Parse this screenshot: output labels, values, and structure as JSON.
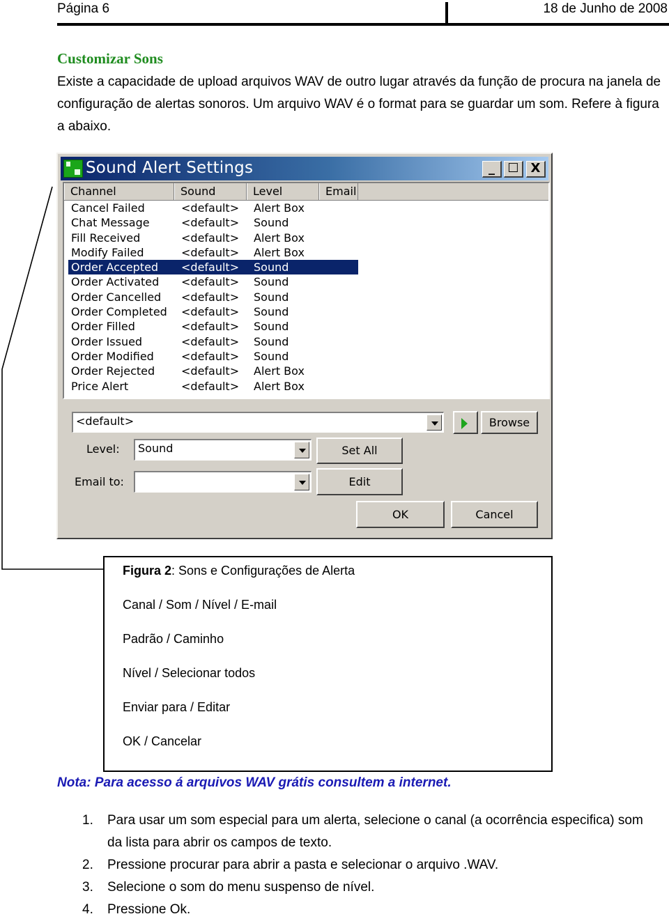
{
  "header": {
    "page_label": "Página 6",
    "date": "18 de Junho de 2008"
  },
  "section": {
    "title": "Customizar Sons",
    "paragraph": "Existe a capacidade de upload arquivos WAV de outro lugar através da função de procura na janela de configuração de alertas sonoros. Um arquivo WAV é o format para se guardar um som. Refere à figura a abaixo."
  },
  "dialog": {
    "title": "Sound Alert Settings",
    "icons": {
      "app": "app-logo-icon",
      "minimize": "minimize-icon",
      "maximize": "maximize-icon",
      "close": "close-icon",
      "play": "play-icon",
      "dropdown": "chevron-down-icon"
    },
    "title_buttons": {
      "minimize": "_",
      "maximize": "☐",
      "close": "X"
    },
    "columns": [
      "Channel",
      "Sound",
      "Level",
      "Email"
    ],
    "rows": [
      {
        "channel": "Cancel Failed",
        "sound": "<default>",
        "level": "Alert Box",
        "email": ""
      },
      {
        "channel": "Chat Message",
        "sound": "<default>",
        "level": "Sound",
        "email": ""
      },
      {
        "channel": "Fill Received",
        "sound": "<default>",
        "level": "Alert Box",
        "email": ""
      },
      {
        "channel": "Modify Failed",
        "sound": "<default>",
        "level": "Alert Box",
        "email": ""
      },
      {
        "channel": "Order Accepted",
        "sound": "<default>",
        "level": "Sound",
        "email": "",
        "selected": true
      },
      {
        "channel": "Order Activated",
        "sound": "<default>",
        "level": "Sound",
        "email": ""
      },
      {
        "channel": "Order Cancelled",
        "sound": "<default>",
        "level": "Sound",
        "email": ""
      },
      {
        "channel": "Order Completed",
        "sound": "<default>",
        "level": "Sound",
        "email": ""
      },
      {
        "channel": "Order Filled",
        "sound": "<default>",
        "level": "Sound",
        "email": ""
      },
      {
        "channel": "Order Issued",
        "sound": "<default>",
        "level": "Sound",
        "email": ""
      },
      {
        "channel": "Order Modified",
        "sound": "<default>",
        "level": "Sound",
        "email": ""
      },
      {
        "channel": "Order Rejected",
        "sound": "<default>",
        "level": "Alert Box",
        "email": ""
      },
      {
        "channel": "Price Alert",
        "sound": "<default>",
        "level": "Alert Box",
        "email": ""
      }
    ],
    "sound_combo_value": "<default>",
    "browse_label": "Browse",
    "level_label": "Level:",
    "level_value": "Sound",
    "set_all_label": "Set All",
    "email_label": "Email to:",
    "email_value": "",
    "edit_label": "Edit",
    "ok_label": "OK",
    "cancel_label": "Cancel",
    "colors": {
      "selection": "#0a246a",
      "titlebar_start": "#0a246a",
      "titlebar_end": "#a6caf0",
      "face": "#d4d0c8"
    }
  },
  "caption": {
    "figure_label": "Figura 2",
    "figure_title": ": Sons e Configurações de Alerta",
    "lines": [
      "Canal / Som / Nível / E-mail",
      "Padrão / Caminho",
      "Nível / Selecionar todos",
      "Enviar para / Editar",
      "OK / Cancelar"
    ]
  },
  "note": "Nota: Para acesso á arquivos WAV grátis consultem a internet.",
  "steps": [
    {
      "num": "1.",
      "text": "Para usar um som especial para um alerta, selecione o canal (a ocorrência especifica) som da lista para abrir os campos de texto."
    },
    {
      "num": "2.",
      "text": "Pressione procurar para abrir a pasta e selecionar o arquivo .WAV."
    },
    {
      "num": "3.",
      "text": "Selecione o som do menu suspenso de nível."
    },
    {
      "num": "4.",
      "text": "Pressione Ok."
    }
  ],
  "colors": {
    "section_title": "#1f8c1f",
    "note": "#1a1ab4"
  }
}
